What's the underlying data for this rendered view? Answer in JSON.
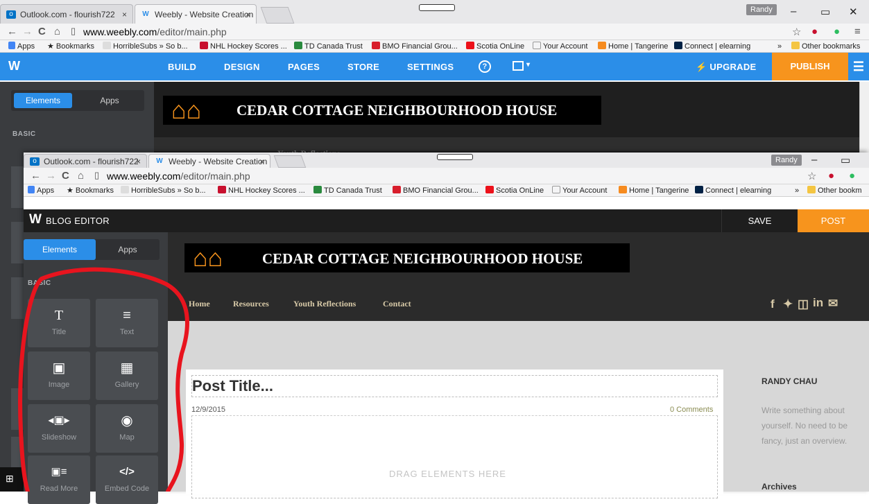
{
  "browser": {
    "tabs": [
      {
        "label": "Outlook.com - flourish722",
        "close": "×"
      },
      {
        "label": "Weebly - Website Creation",
        "close": "×"
      }
    ],
    "profile": "Randy",
    "url_host": "www.weebly.com",
    "url_path": "/editor/main.php",
    "bookmarks": [
      "Apps",
      "Bookmarks",
      "HorribleSubs » So b...",
      "NHL Hockey Scores ...",
      "TD Canada Trust",
      "BMO Financial Grou...",
      "Scotia OnLine",
      "Your Account",
      "Home | Tangerine",
      "Connect | elearning"
    ],
    "more": "»",
    "other_bookmarks": "Other bookmarks",
    "other_bookmarks_cut": "Other bookm",
    "minimize": "–",
    "restore": "▭",
    "close": "✕"
  },
  "editor": {
    "nav": [
      "BUILD",
      "DESIGN",
      "PAGES",
      "STORE",
      "SETTINGS"
    ],
    "help": "?",
    "upgrade": "UPGRADE",
    "publish": "PUBLISH",
    "tab_elements": "Elements",
    "tab_apps": "Apps",
    "basic": "BASIC"
  },
  "blog_editor": {
    "title": "BLOG EDITOR",
    "save": "SAVE",
    "post": "POST",
    "tab_elements": "Elements",
    "tab_apps": "Apps",
    "basic": "BASIC",
    "elements": [
      {
        "glyph": "T",
        "label": "Title"
      },
      {
        "glyph": "≡",
        "label": "Text"
      },
      {
        "glyph": "▣",
        "label": "Image"
      },
      {
        "glyph": "▦",
        "label": "Gallery"
      },
      {
        "glyph": "◂▣▸",
        "label": "Slideshow"
      },
      {
        "glyph": "◉",
        "label": "Map"
      },
      {
        "glyph": "▣≡",
        "label": "Read More"
      },
      {
        "glyph": "</>",
        "label": "Embed Code"
      }
    ]
  },
  "site": {
    "banner": "CEDAR COTTAGE NEIGHBOURHOOD HOUSE",
    "menu": [
      "Home",
      "Resources",
      "Youth Reflections",
      "Contact"
    ],
    "back_menu_fragment": "Youth Reflections",
    "social": [
      "f",
      "🐦",
      "📷",
      "in",
      "✉"
    ],
    "post_title": "Post Title...",
    "post_date": "12/9/2015",
    "comments": "0 Comments",
    "drag_hint": "DRAG ELEMENTS HERE",
    "sidebar_name": "RANDY CHAU",
    "sidebar_text": "Write something about yourself. No need to be fancy, just an overview.",
    "archives": "Archives"
  },
  "colors": {
    "accent": "#2b8ee8",
    "publish": "#f7941d",
    "annotation": "#e8141e"
  }
}
